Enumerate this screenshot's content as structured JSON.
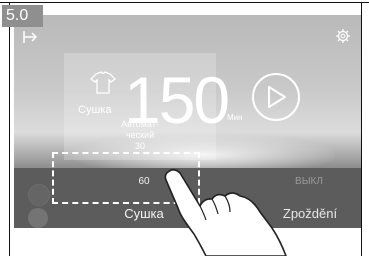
{
  "step": {
    "label": "5.0"
  },
  "program": {
    "mode_label": "Сушка",
    "duration": "150",
    "unit": "Мин",
    "auto_text": "Автомат-\nческий\n30"
  },
  "options": {
    "dry": {
      "value": "60",
      "label": "Сушка"
    },
    "delay": {
      "value": "ВЫКЛ",
      "label": "Zpoždění"
    }
  },
  "icons": {
    "back": "back-icon",
    "settings": "gear-icon",
    "shirt": "shirt-icon",
    "play": "play-icon"
  },
  "colors": {
    "screen_top": "#b9b9b9",
    "bottom_bar": "#5c5c5c",
    "badge": "#8f8f8f"
  }
}
